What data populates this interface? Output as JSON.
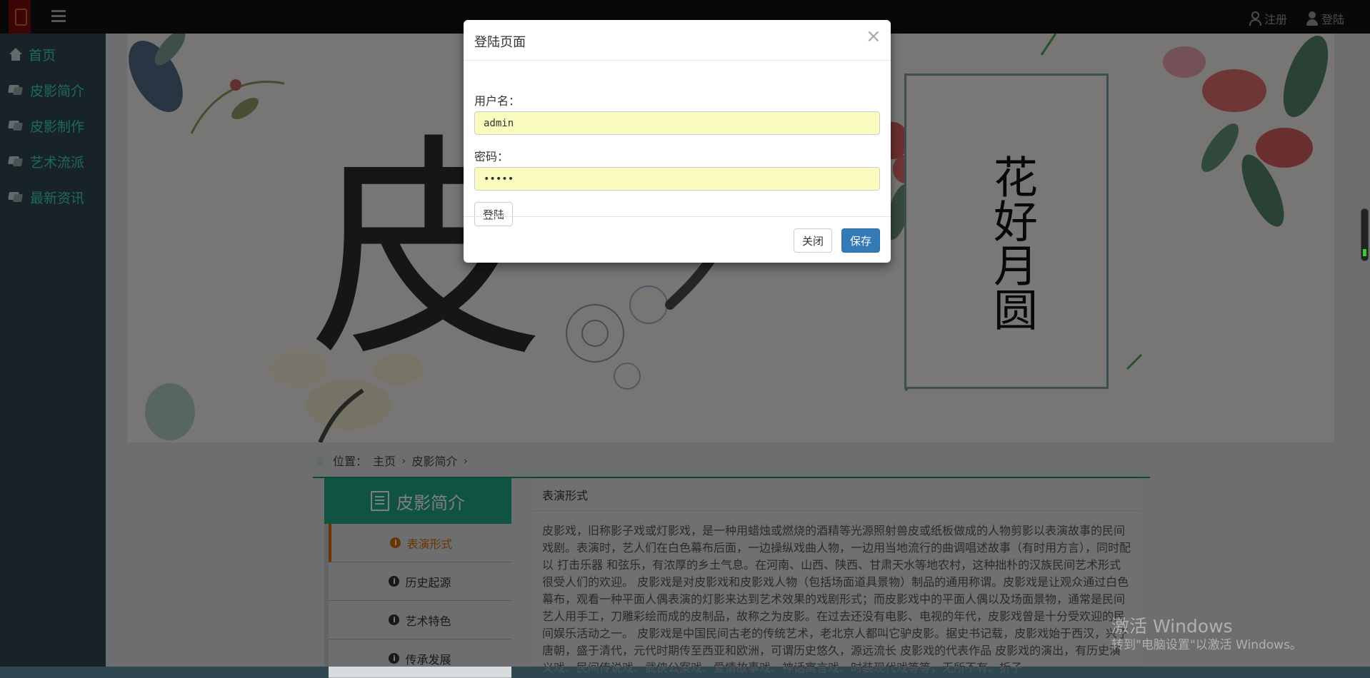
{
  "topbar": {
    "register_label": "注册",
    "login_label": "登陆"
  },
  "sidebar": {
    "items": [
      {
        "label": "首页",
        "icon": "home-icon"
      },
      {
        "label": "皮影简介",
        "icon": "tags-icon"
      },
      {
        "label": "皮影制作",
        "icon": "tags-icon"
      },
      {
        "label": "艺术流派",
        "icon": "tags-icon"
      },
      {
        "label": "最新资讯",
        "icon": "tags-icon"
      }
    ]
  },
  "banner": {
    "big_char": "皮",
    "poster_text": "花好月圆"
  },
  "breadcrumb": {
    "prefix": "位置：",
    "items": [
      "主页",
      "皮影简介"
    ]
  },
  "section": {
    "title": "皮影简介",
    "items": [
      "表演形式",
      "历史起源",
      "艺术特色",
      "传承发展"
    ]
  },
  "article": {
    "title": "表演形式",
    "body": "皮影戏，旧称影子戏或灯影戏，是一种用蜡烛或燃烧的酒精等光源照射兽皮或纸板做成的人物剪影以表演故事的民间戏剧。表演时，艺人们在白色幕布后面，一边操纵戏曲人物，一边用当地流行的曲调唱述故事（有时用方言），同时配以 打击乐器 和弦乐，有浓厚的乡土气息。在河南、山西、陕西、甘肃天水等地农村，这种拙朴的汉族民间艺术形式很受人们的欢迎。 皮影戏是对皮影戏和皮影戏人物（包括场面道具景物）制品的通用称谓。皮影戏是让观众通过白色幕布，观看一种平面人偶表演的灯影来达到艺术效果的戏剧形式；而皮影戏中的平面人偶以及场面景物，通常是民间艺人用手工，刀雕彩绘而成的皮制品，故称之为皮影。在过去还没有电影、电视的年代，皮影戏曾是十分受欢迎的民间娱乐活动之一。 皮影戏是中国民间古老的传统艺术，老北京人都叫它驴皮影。据史书记载，皮影戏始于西汉，兴于唐朝，盛于清代，元代时期传至西亚和欧洲，可谓历史悠久，源远流长 皮影戏的代表作品 皮影戏的演出，有历史演义戏、民间传说戏、武侠公案戏、爱情故事戏、神话寓言戏、时装现代戏等等，无所不有。折子"
  },
  "watermark": {
    "line1": "激活 Windows",
    "line2": "转到\"电脑设置\"以激活 Windows。"
  },
  "modal": {
    "title": "登陆页面",
    "close_glyph": "×",
    "username_label": "用户名：",
    "username_value": "admin",
    "password_label": "密码：",
    "password_value": "•••••",
    "login_button": "登陆",
    "close_button": "关闭",
    "save_button": "保存"
  },
  "colors": {
    "sidebar_link": "#3fd3b6",
    "section_accent": "#1fa681",
    "active_item": "#d46a00",
    "primary_button": "#337ab7",
    "autofill_bg": "#fafdbf"
  }
}
